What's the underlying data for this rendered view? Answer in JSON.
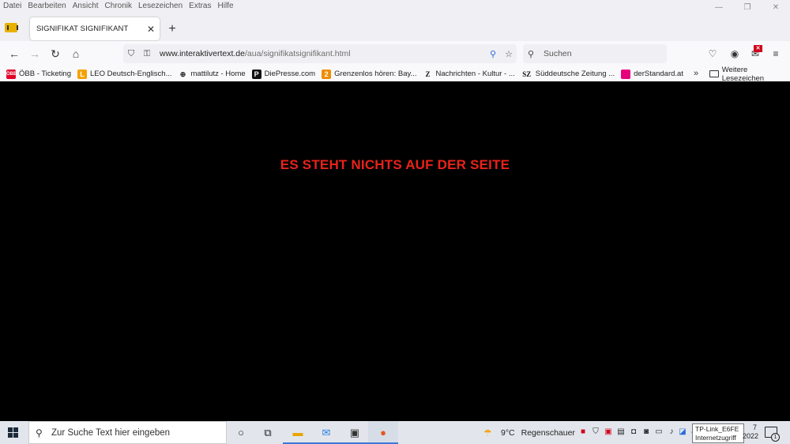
{
  "menu": [
    "Datei",
    "Bearbeiten",
    "Ansicht",
    "Chronik",
    "Lesezeichen",
    "Extras",
    "Hilfe"
  ],
  "tab": {
    "title": "SIGNIFIKAT SIGNIFIKANT"
  },
  "url": {
    "domain": "www.interaktivertext.de",
    "path": "/aua/signifikatsignifikant.html"
  },
  "search": {
    "placeholder": "Suchen"
  },
  "bookmarks": [
    {
      "label": "ÖBB - Ticketing",
      "color": "#e2002a",
      "glyph": "ÖBB"
    },
    {
      "label": "LEO Deutsch-Englisch...",
      "color": "#f5a100",
      "glyph": "L"
    },
    {
      "label": "mattilutz - Home",
      "color": "#ffffff",
      "glyph": "⊕"
    },
    {
      "label": "DiePresse.com",
      "color": "#111111",
      "glyph": "P"
    },
    {
      "label": "Grenzenlos hören: Bay...",
      "color": "#f08c00",
      "glyph": "2"
    },
    {
      "label": "Nachrichten - Kultur - ...",
      "color": "#ffffff",
      "glyph": "Z"
    },
    {
      "label": "Süddeutsche Zeitung ...",
      "color": "#ffffff",
      "glyph": "SZ"
    },
    {
      "label": "derStandard.at",
      "color": "#e6007e",
      "glyph": ""
    }
  ],
  "bookmarks_folder": "Weitere Lesezeichen",
  "page": {
    "headline": "ES STEHT NICHTS AUF DER SEITE",
    "headline_color": "#e8231a",
    "background": "#000000"
  },
  "taskbar": {
    "search_placeholder": "Zur Suche Text hier eingeben",
    "weather_temp": "9°C",
    "weather_text": "Regenschauer",
    "tooltip_line1": "TP-Link_E6FE",
    "tooltip_line2": "Internetzugriff",
    "clock_fragment": "7",
    "date_fragment": "2022",
    "notification_count": "1"
  }
}
